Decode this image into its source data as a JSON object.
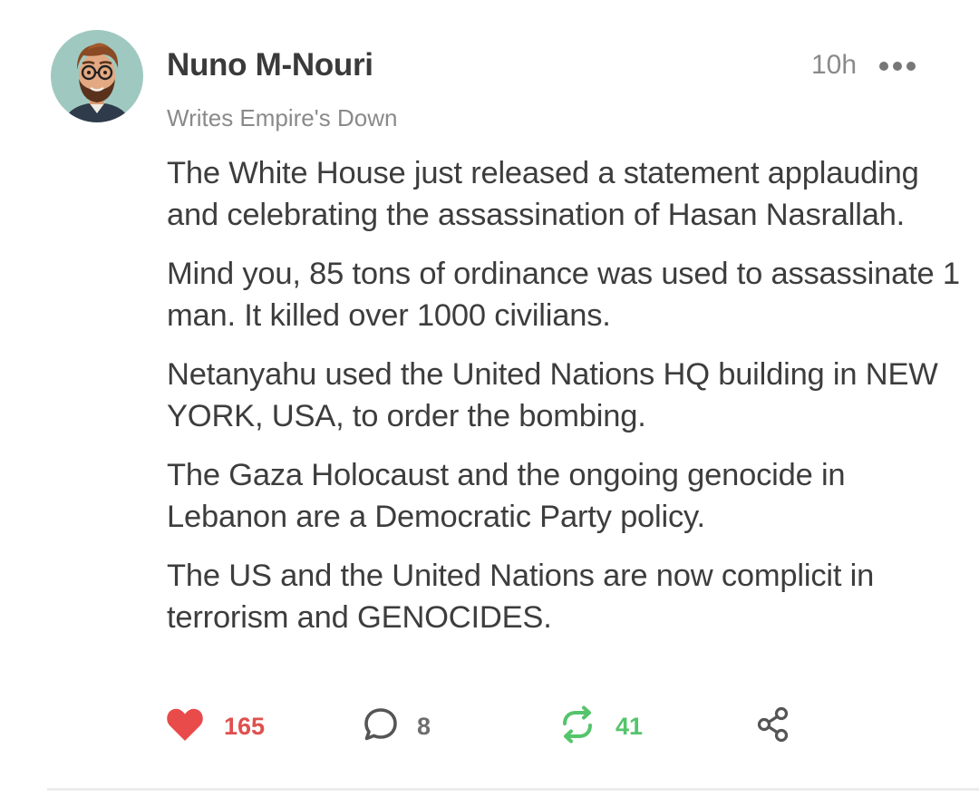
{
  "post": {
    "author_name": "Nuno M-Nouri",
    "author_subtitle": "Writes Empire's Down",
    "timestamp": "10h",
    "paragraphs": [
      "The White House just released a statement applauding and celebrating the assassination of Hasan Nasrallah.",
      "Mind you, 85 tons of ordinance was used to assassinate 1 man. It killed over 1000 civilians.",
      "Netanyahu used the United Nations HQ building in NEW YORK, USA, to order the bombing.",
      "The Gaza Holocaust and the ongoing genocide in Lebanon are a Democratic Party policy.",
      "The US and the United Nations are now complicit in terrorism and GENOCIDES."
    ]
  },
  "actions": {
    "like_count": "165",
    "comment_count": "8",
    "restack_count": "41"
  },
  "icons": {
    "avatar": "avatar-icon",
    "more": "more-dots-icon",
    "like": "heart-icon",
    "comment": "comment-bubble-icon",
    "restack": "restack-arrows-icon",
    "share": "share-icon"
  },
  "colors": {
    "like": "#e94a4a",
    "restack": "#55c46c",
    "text": "#3d3d3d",
    "muted": "#8a8a8a"
  }
}
